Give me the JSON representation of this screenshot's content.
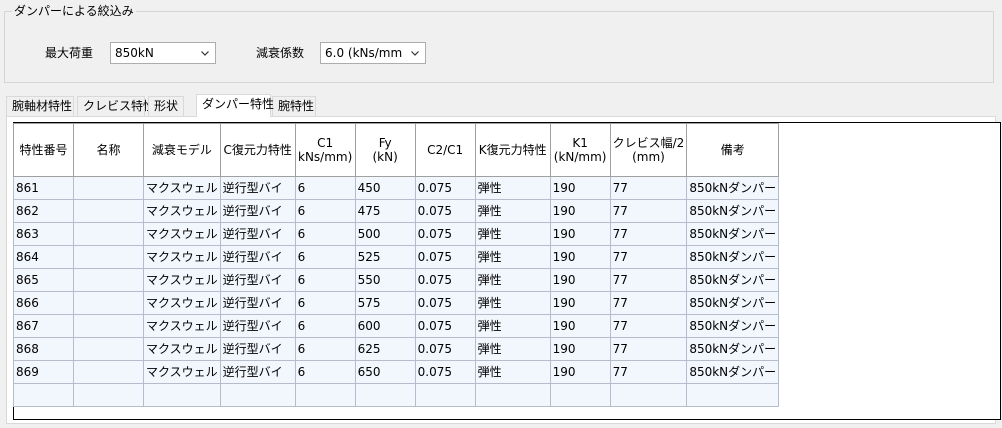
{
  "filter": {
    "group_title": "ダンパーによる絞込み",
    "max_load_label": "最大荷重",
    "max_load_value": "850kN",
    "damping_label": "減衰係数",
    "damping_value": "6.0 (kNs/mm"
  },
  "tabs": [
    {
      "label": "腕軸材特性"
    },
    {
      "label": "クレビス特性"
    },
    {
      "label": "形状"
    },
    {
      "label": "ダンパー特性"
    },
    {
      "label": "腕特性"
    }
  ],
  "active_tab": "ダンパー特性",
  "grid": {
    "headers": [
      [
        "特性番号"
      ],
      [
        "名称"
      ],
      [
        "減衰モデル"
      ],
      [
        "C復元力特性"
      ],
      [
        "C1",
        "kNs/mm)"
      ],
      [
        "Fy",
        "(kN)"
      ],
      [
        "C2/C1"
      ],
      [
        "K復元力特性"
      ],
      [
        "K1",
        "(kN/mm)"
      ],
      [
        "クレビス幅/2",
        "(mm)"
      ],
      [
        "備考"
      ]
    ],
    "rows": [
      [
        "861",
        "",
        "マクスウェル",
        "逆行型バイ",
        "6",
        "450",
        "0.075",
        "弾性",
        "190",
        "77",
        "850kNダンパー"
      ],
      [
        "862",
        "",
        "マクスウェル",
        "逆行型バイ",
        "6",
        "475",
        "0.075",
        "弾性",
        "190",
        "77",
        "850kNダンパー"
      ],
      [
        "863",
        "",
        "マクスウェル",
        "逆行型バイ",
        "6",
        "500",
        "0.075",
        "弾性",
        "190",
        "77",
        "850kNダンパー"
      ],
      [
        "864",
        "",
        "マクスウェル",
        "逆行型バイ",
        "6",
        "525",
        "0.075",
        "弾性",
        "190",
        "77",
        "850kNダンパー"
      ],
      [
        "865",
        "",
        "マクスウェル",
        "逆行型バイ",
        "6",
        "550",
        "0.075",
        "弾性",
        "190",
        "77",
        "850kNダンパー"
      ],
      [
        "866",
        "",
        "マクスウェル",
        "逆行型バイ",
        "6",
        "575",
        "0.075",
        "弾性",
        "190",
        "77",
        "850kNダンパー"
      ],
      [
        "867",
        "",
        "マクスウェル",
        "逆行型バイ",
        "6",
        "600",
        "0.075",
        "弾性",
        "190",
        "77",
        "850kNダンパー"
      ],
      [
        "868",
        "",
        "マクスウェル",
        "逆行型バイ",
        "6",
        "625",
        "0.075",
        "弾性",
        "190",
        "77",
        "850kNダンパー"
      ],
      [
        "869",
        "",
        "マクスウェル",
        "逆行型バイ",
        "6",
        "650",
        "0.075",
        "弾性",
        "190",
        "77",
        "850kNダンパー"
      ],
      [
        "",
        "",
        "",
        "",
        "",
        "",
        "",
        "",
        "",
        "",
        ""
      ]
    ]
  }
}
